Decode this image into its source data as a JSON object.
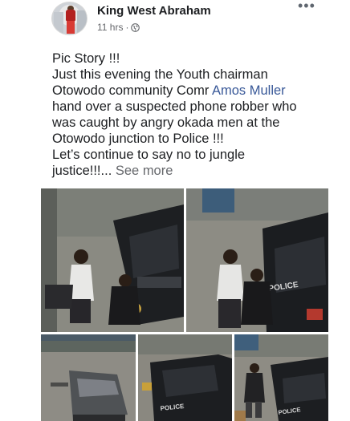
{
  "post": {
    "author": "King West Abraham",
    "time": "11 hrs",
    "separator": "·",
    "more_glyph": "•••",
    "text_lines": [
      "Pic Story !!!",
      "Just this evening the Youth chairman",
      "Otowodo community Comr ",
      "hand over a suspected phone robber who",
      "was caught by angry okada men at the",
      "Otowodo junction to Police !!!",
      "Let’s continue to say no to jungle",
      "justice!!!..."
    ],
    "mention": "Amos Muller",
    "see_more": "See more",
    "vehicle_label": "POLICE",
    "icons": {
      "privacy": "globe-icon",
      "menu": "more-options-icon"
    },
    "colors": {
      "link": "#385898",
      "meta": "#65676b",
      "text": "#1c1e21"
    }
  }
}
